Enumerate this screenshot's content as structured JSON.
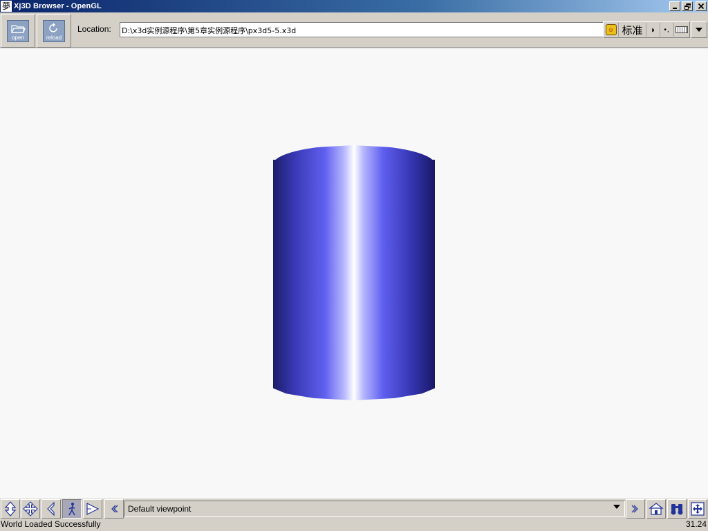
{
  "window": {
    "title": "Xj3D Browser - OpenGL",
    "icon_glyph": "夢"
  },
  "toolbar": {
    "open_label": "open",
    "reload_label": "reload",
    "location_label": "Location:",
    "location_value": "D:\\x3d实例源程序\\第5章实例源程序\\px3d5-5.x3d"
  },
  "ime": {
    "mode_label": "标准",
    "icons": [
      "ime-logo-icon",
      "moon-icon",
      "punctuation-icon",
      "soft-keyboard-icon"
    ]
  },
  "scene": {
    "object": "cylinder",
    "colors": {
      "background": "#f8f8f8",
      "dark": "#1c1c6c",
      "mid": "#6060f0",
      "highlight": "#ffffff"
    }
  },
  "navbar": {
    "viewpoint_label": "Default viewpoint",
    "buttons": [
      "fly-icon",
      "pan-icon",
      "tilt-icon",
      "walk-icon",
      "examine-icon",
      "prev-viewpoint-icon",
      "next-viewpoint-icon",
      "home-icon",
      "look-at-icon",
      "fit-view-icon"
    ]
  },
  "status": {
    "message": "World Loaded Successfully",
    "fps": "31.24"
  }
}
